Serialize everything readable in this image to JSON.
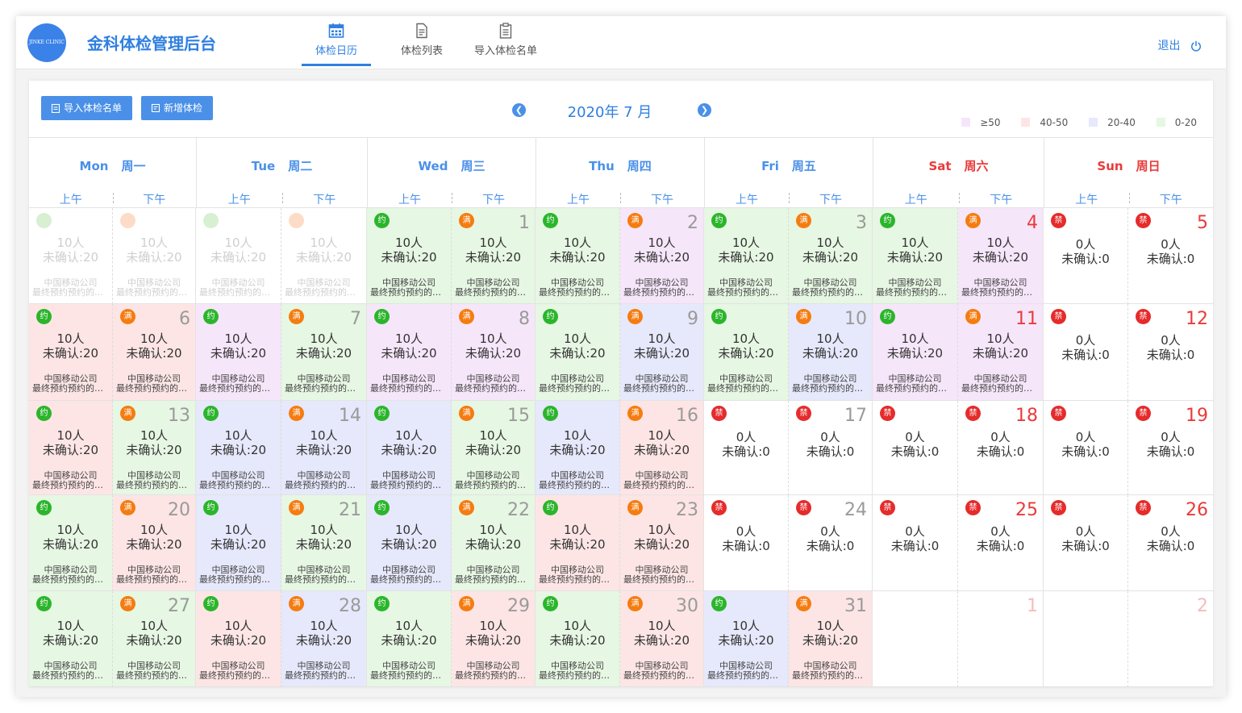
{
  "app": {
    "logo_text": "JINKE CLINIC",
    "title": "金科体检管理后台",
    "nav": [
      {
        "label": "体检日历",
        "icon": "calendar-icon",
        "active": true
      },
      {
        "label": "体检列表",
        "icon": "document-icon",
        "active": false
      },
      {
        "label": "导入体检名单",
        "icon": "clipboard-icon",
        "active": false
      }
    ],
    "logout_label": "退出"
  },
  "toolbar": {
    "import_label": "导入体检名单",
    "add_label": "新增体检",
    "month_title": "2020年 7 月"
  },
  "legend": [
    {
      "label": "≥50",
      "color": "#f6e6fa"
    },
    {
      "label": "40-50",
      "color": "#fde5e5"
    },
    {
      "label": "20-40",
      "color": "#e6e8fb"
    },
    {
      "label": "0-20",
      "color": "#e6f7e3"
    }
  ],
  "colors": {
    "purple": "#f6e6fa",
    "red": "#fde5e5",
    "blue": "#e6e8fb",
    "green": "#e6f7e3",
    "badge_am": "#2bb52b",
    "badge_pm": "#f57c10",
    "badge_off": "#e52b2b",
    "past_am": "#d7f0d2",
    "past_pm": "#fddcc7"
  },
  "weekdays": [
    {
      "en": "Mon",
      "zh": "周一",
      "weekend": false
    },
    {
      "en": "Tue",
      "zh": "周二",
      "weekend": false
    },
    {
      "en": "Wed",
      "zh": "周三",
      "weekend": false
    },
    {
      "en": "Thu",
      "zh": "周四",
      "weekend": false
    },
    {
      "en": "Fri",
      "zh": "周五",
      "weekend": false
    },
    {
      "en": "Sat",
      "zh": "周六",
      "weekend": true
    },
    {
      "en": "Sun",
      "zh": "周日",
      "weekend": true
    }
  ],
  "halves": {
    "am": "上午",
    "pm": "下午"
  },
  "labels": {
    "badge_am": "约",
    "badge_pm": "满",
    "badge_off": "禁",
    "people": "10人",
    "unconfirmed": "未确认:20",
    "people_zero": "0人",
    "unconfirmed_zero": "未确认:0",
    "org": "中国移动公司",
    "last_appt": "最终预约预约的日期"
  },
  "calendar": {
    "weeks": [
      [
        {
          "type": "past",
          "day": ""
        },
        {
          "type": "past",
          "day": ""
        },
        {
          "type": "work",
          "day": "1",
          "am": "green",
          "pm": "green"
        },
        {
          "type": "work",
          "day": "2",
          "am": "green",
          "pm": "purple"
        },
        {
          "type": "work",
          "day": "3",
          "am": "green",
          "pm": "green"
        },
        {
          "type": "work",
          "day": "4",
          "am": "green",
          "pm": "purple"
        },
        {
          "type": "off",
          "day": "5"
        }
      ],
      [
        {
          "type": "work",
          "day": "6",
          "am": "red",
          "pm": "red"
        },
        {
          "type": "work",
          "day": "7",
          "am": "purple",
          "pm": "green"
        },
        {
          "type": "work",
          "day": "8",
          "am": "purple",
          "pm": "purple"
        },
        {
          "type": "work",
          "day": "9",
          "am": "green",
          "pm": "blue"
        },
        {
          "type": "work",
          "day": "10",
          "am": "green",
          "pm": "blue"
        },
        {
          "type": "work",
          "day": "11",
          "am": "purple",
          "pm": "purple"
        },
        {
          "type": "off",
          "day": "12"
        }
      ],
      [
        {
          "type": "work",
          "day": "13",
          "am": "red",
          "pm": "green"
        },
        {
          "type": "work",
          "day": "14",
          "am": "blue",
          "pm": "blue"
        },
        {
          "type": "work",
          "day": "15",
          "am": "blue",
          "pm": "green"
        },
        {
          "type": "work",
          "day": "16",
          "am": "blue",
          "pm": "red"
        },
        {
          "type": "off",
          "day": "17"
        },
        {
          "type": "off",
          "day": "18"
        },
        {
          "type": "off",
          "day": "19"
        }
      ],
      [
        {
          "type": "work",
          "day": "20",
          "am": "green",
          "pm": "red"
        },
        {
          "type": "work",
          "day": "21",
          "am": "blue",
          "pm": "green"
        },
        {
          "type": "work",
          "day": "22",
          "am": "blue",
          "pm": "green"
        },
        {
          "type": "work",
          "day": "23",
          "am": "red",
          "pm": "red"
        },
        {
          "type": "off",
          "day": "24"
        },
        {
          "type": "off",
          "day": "25"
        },
        {
          "type": "off",
          "day": "26"
        }
      ],
      [
        {
          "type": "work",
          "day": "27",
          "am": "green",
          "pm": "green"
        },
        {
          "type": "work",
          "day": "28",
          "am": "red",
          "pm": "blue"
        },
        {
          "type": "work",
          "day": "29",
          "am": "green",
          "pm": "red"
        },
        {
          "type": "work",
          "day": "30",
          "am": "green",
          "pm": "red"
        },
        {
          "type": "work",
          "day": "31",
          "am": "blue",
          "pm": "red"
        },
        {
          "type": "next",
          "day": "1"
        },
        {
          "type": "next",
          "day": "2"
        }
      ]
    ]
  }
}
